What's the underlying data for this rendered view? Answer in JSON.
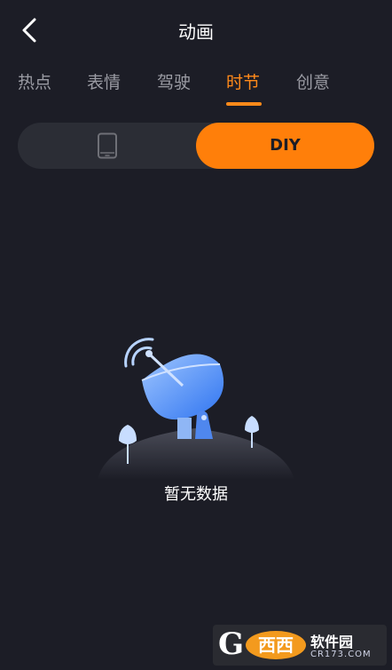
{
  "header": {
    "title": "动画"
  },
  "tabs": [
    {
      "label": "热点",
      "active": false
    },
    {
      "label": "表情",
      "active": false
    },
    {
      "label": "驾驶",
      "active": false
    },
    {
      "label": "时节",
      "active": true
    },
    {
      "label": "创意",
      "active": false
    }
  ],
  "toggle": {
    "left_icon": "phone-icon",
    "right_label": "DIY",
    "selected": "DIY"
  },
  "empty_state": {
    "message": "暂无数据",
    "illustration_icon": "satellite-dish-icon"
  },
  "watermark": {
    "brand_text": "软件园",
    "site_text": "CR173.COM",
    "logo_text": "西西"
  },
  "colors": {
    "background": "#1c1d26",
    "accent": "#ff8a1a",
    "toggle_bg": "#2b2d35",
    "tab_inactive": "#9a9ba3"
  }
}
